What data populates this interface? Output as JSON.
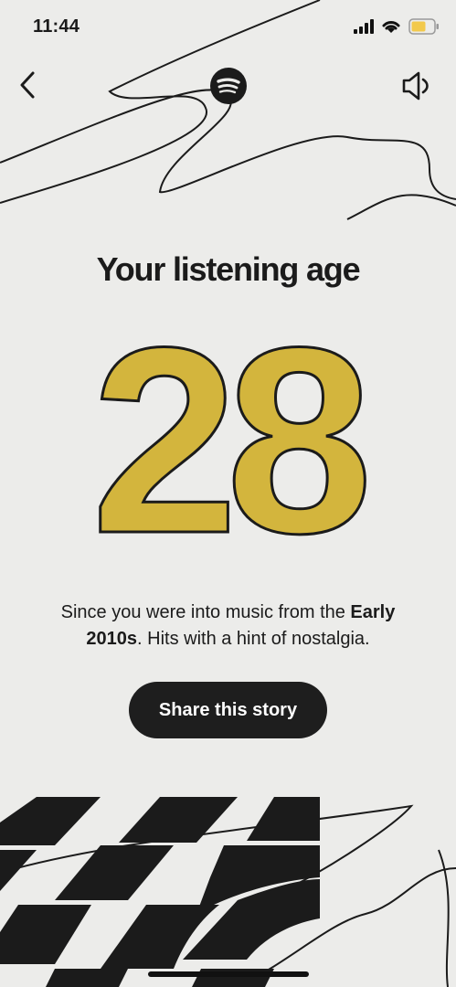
{
  "status_bar": {
    "time": "11:44",
    "battery_color": "#f2c94c"
  },
  "header": {
    "back_icon": "chevron-left-icon",
    "logo": "spotify-logo",
    "sound_icon": "speaker-icon"
  },
  "main": {
    "title": "Your listening age",
    "age": "28",
    "age_color": "#d3b53d",
    "description_pre": "Since you were into music from the ",
    "description_bold": "Early 2010s",
    "description_post": ". Hits with a hint of nostalgia.",
    "share_label": "Share this story"
  }
}
